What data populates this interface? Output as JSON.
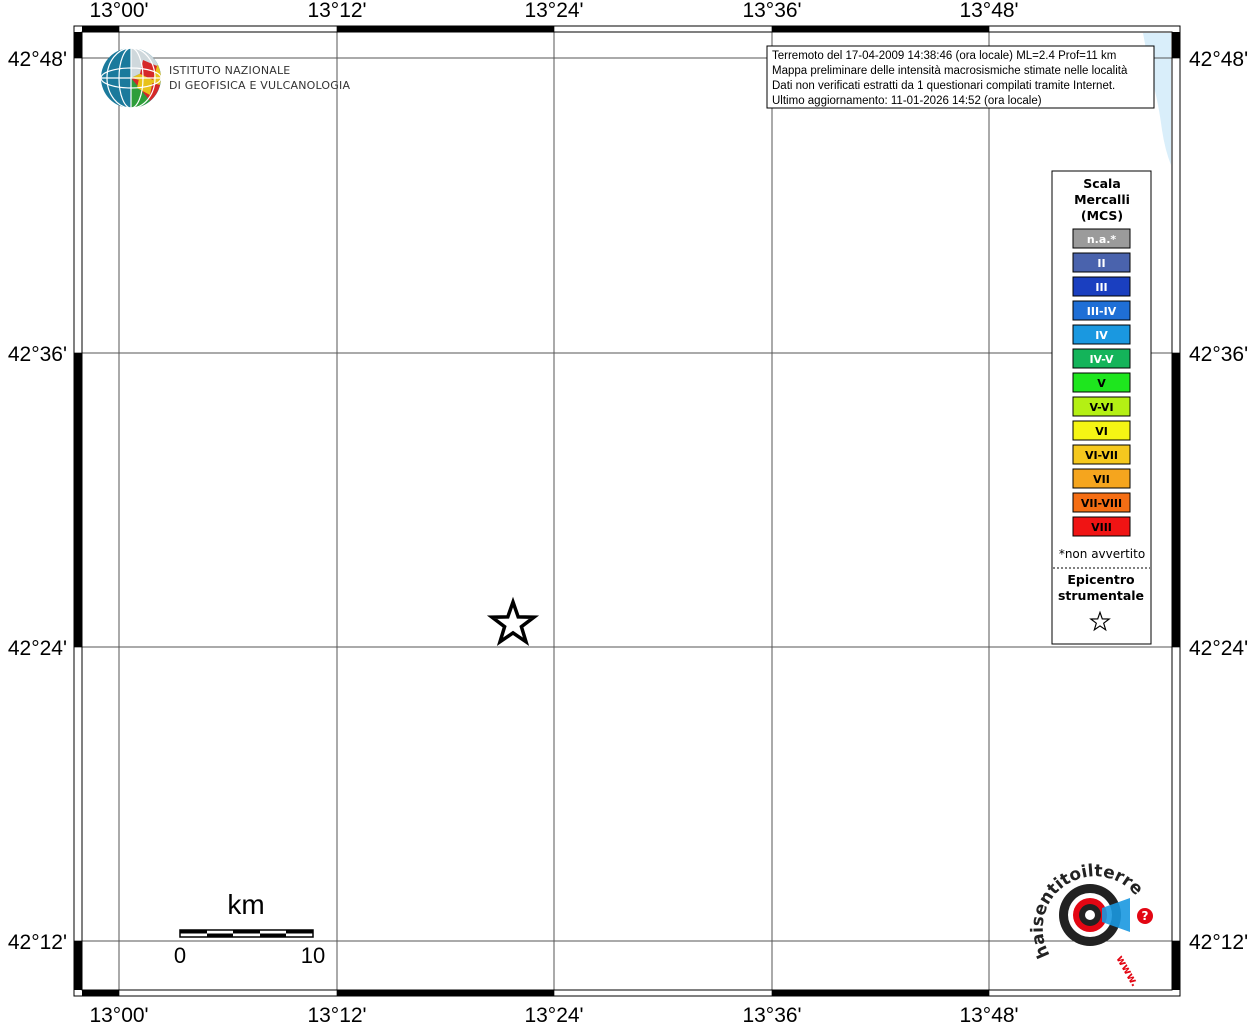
{
  "map": {
    "lon_labels": [
      "13°00'",
      "13°12'",
      "13°24'",
      "13°36'",
      "13°48'"
    ],
    "lat_labels": [
      "42°48'",
      "42°36'",
      "42°24'",
      "42°12'"
    ]
  },
  "info": {
    "lines": [
      "Terremoto del 17-04-2009 14:38:46 (ora locale) ML=2.4 Prof=11 km",
      "Mappa preliminare delle intensità macrosismiche stimate nelle località",
      "Dati non verificati estratti da 1 questionari compilati tramite Internet.",
      "Ultimo aggiornamento: 11-01-2026 14:52 (ora locale)"
    ]
  },
  "logo": {
    "line1": "ISTITUTO NAZIONALE",
    "line2": "DI GEOFISICA E VULCANOLOGIA"
  },
  "legend": {
    "title_lines": [
      "Scala",
      "Mercalli",
      "(MCS)"
    ],
    "items": [
      {
        "label": "n.a.*",
        "color": "#9b9b9b"
      },
      {
        "label": "II",
        "color": "#4a63ad"
      },
      {
        "label": "III",
        "color": "#1a3fc0"
      },
      {
        "label": "III-IV",
        "color": "#1f6fd6"
      },
      {
        "label": "IV",
        "color": "#1a98e0"
      },
      {
        "label": "IV-V",
        "color": "#14b45a"
      },
      {
        "label": "V",
        "color": "#1ee61e"
      },
      {
        "label": "V-VI",
        "color": "#b4f014"
      },
      {
        "label": "VI",
        "color": "#f5f514"
      },
      {
        "label": "VI-VII",
        "color": "#f5c81e"
      },
      {
        "label": "VII",
        "color": "#f5a51e"
      },
      {
        "label": "VII-VIII",
        "color": "#f56e14"
      },
      {
        "label": "VIII",
        "color": "#f01414"
      }
    ],
    "note": "*non avvertito",
    "epicenter_lines": [
      "Epicentro",
      "strumentale"
    ],
    "epicenter_symbol": "☆"
  },
  "scale_bar": {
    "unit": "km",
    "min_label": "0",
    "max_label": "10"
  },
  "hst_logo": {
    "ring_text": "haisentitoilterremoto.it",
    "www": "www.",
    "question": "?"
  },
  "colors": {
    "water": "#d9eefa",
    "frame": "#000000",
    "grid": "#555555",
    "hst_red": "#e30613"
  }
}
